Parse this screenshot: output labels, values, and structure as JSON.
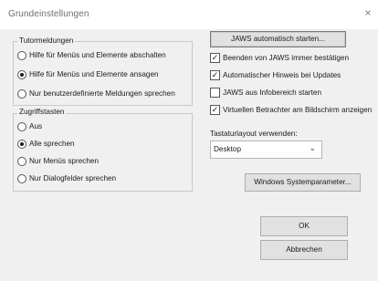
{
  "window": {
    "title": "Grundeinstellungen",
    "close_glyph": "×"
  },
  "tutor": {
    "legend": "Tutormeldungen",
    "options": [
      {
        "label": "Hilfe für Menüs und Elemente abschalten",
        "selected": false
      },
      {
        "label": "Hilfe für Menüs und Elemente ansagen",
        "selected": true
      },
      {
        "label": "Nur benutzerdefinierte Meldungen sprechen",
        "selected": false
      }
    ]
  },
  "hotkeys": {
    "legend": "Zugriffstasten",
    "options": [
      {
        "label": "Aus",
        "selected": false
      },
      {
        "label": "Alle sprechen",
        "selected": true
      },
      {
        "label": "Nur Menüs sprechen",
        "selected": false
      },
      {
        "label": "Nur Dialogfelder sprechen",
        "selected": false
      }
    ]
  },
  "right": {
    "autostart_button": "JAWS automatisch starten...",
    "checkboxes": [
      {
        "label": "Beenden von JAWS immer bestätigen",
        "checked": true
      },
      {
        "label": "Automatischer Hinweis bei Updates",
        "checked": true
      },
      {
        "label": "JAWS aus Infobereich starten",
        "checked": false
      },
      {
        "label": "Virtuellen Betrachter am Bildschirm anzeigen",
        "checked": true
      }
    ],
    "layout_label": "Tastaturlayout verwenden:",
    "layout_value": "Desktop",
    "system_params_button": "Windows Systemparameter...",
    "ok_button": "OK",
    "cancel_button": "Abbrechen"
  },
  "icons": {
    "close": "close-icon",
    "dropdown": "chevron-down-icon",
    "check": "checkmark-icon"
  }
}
